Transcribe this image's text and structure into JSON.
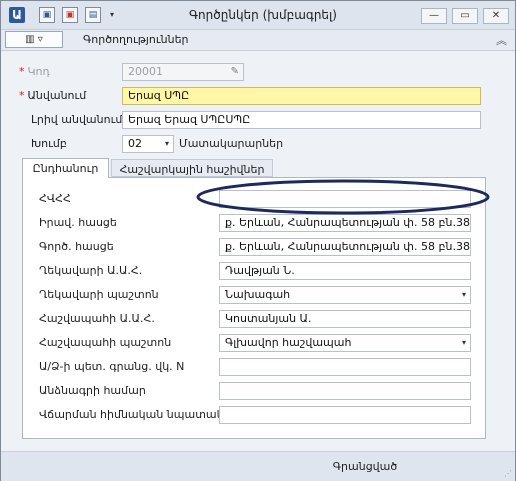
{
  "window": {
    "title": "Գործընկեր (խմբագրել)",
    "app_icon_glyph": "Ա",
    "quick_access": {
      "save_glyph": "▣",
      "save_close_glyph": "▣",
      "new_glyph": "▤",
      "dropdown_glyph": "▾"
    },
    "controls": {
      "minimize_glyph": "—",
      "maximize_glyph": "▭",
      "close_glyph": "✕"
    }
  },
  "ribbon": {
    "menu_button_glyph": "▥ ▿",
    "title": "Գործողություններ",
    "collapse_glyph": "︽"
  },
  "form": {
    "required_mark": "*",
    "code": {
      "label": "Կոդ",
      "value": "20001",
      "wand_glyph": "✎"
    },
    "name": {
      "label": "Անվանում",
      "value": "Երազ ՍՊԸ"
    },
    "full_name": {
      "label": "Լրիվ անվանում",
      "value": "Երազ Երազ ՍՊԸՍՊԸ"
    },
    "group": {
      "label": "Խումբ",
      "value": "02",
      "description": "Մատակարարներ",
      "arrow_glyph": "▾"
    }
  },
  "tabs": [
    {
      "label": "Ընդհանուր"
    },
    {
      "label": "Հաշվարկային հաշիվներ"
    }
  ],
  "general": {
    "tin": {
      "label": "ՀՎՀՀ",
      "value": ""
    },
    "legal_address": {
      "label": "Իրավ. հասցե",
      "value": "ք. Երևան, Հանրապետության փ. 58 բն.38"
    },
    "business_address": {
      "label": "Գործ. հասցե",
      "value": "ք. Երևան, Հանրապետության փ. 58 բն.38"
    },
    "director_name": {
      "label": "Ղեկավարի Ա.Ա.Հ.",
      "value": "Դավթյան Ն."
    },
    "director_position": {
      "label": "Ղեկավարի պաշտոն",
      "value": "Նախագահ",
      "arrow_glyph": "▾"
    },
    "accountant_name": {
      "label": "Հաշվապահի Ա.Ա.Հ.",
      "value": "Կոստանյան Ա."
    },
    "accountant_position": {
      "label": "Հաշվապահի պաշտոն",
      "value": "Գլխավոր հաշվապահ",
      "arrow_glyph": "▾"
    },
    "state_reg_number": {
      "label": "Ա/Ձ-ի պետ. գրանց. վկ. N",
      "value": ""
    },
    "passport_number": {
      "label": "Անձնագրի համար",
      "value": ""
    },
    "payment_basis": {
      "label": "Վճարման հիմնական նպատակ",
      "value": ""
    }
  },
  "status": {
    "registered_label": "Գրանցված",
    "resize_grip_glyph": "⋰"
  },
  "colors": {
    "highlight_ellipse": "#1c2a5e",
    "required_mark": "#d21f1f",
    "name_field_bg": "#fff6a8"
  }
}
